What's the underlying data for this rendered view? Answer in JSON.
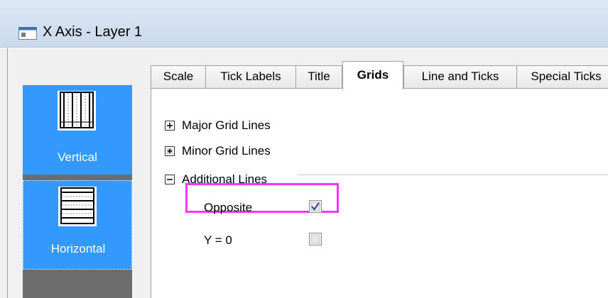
{
  "window": {
    "title": "X Axis - Layer 1"
  },
  "nav": {
    "items": [
      {
        "label": "Vertical",
        "selected": false
      },
      {
        "label": "Horizontal",
        "selected": true
      }
    ]
  },
  "tabs": [
    {
      "label": "Scale",
      "active": false
    },
    {
      "label": "Tick Labels",
      "active": false
    },
    {
      "label": "Title",
      "active": false
    },
    {
      "label": "Grids",
      "active": true
    },
    {
      "label": "Line and Ticks",
      "active": false
    },
    {
      "label": "Special Ticks",
      "active": false
    }
  ],
  "tree": {
    "major": {
      "label": "Major Grid Lines",
      "state": "collapsed"
    },
    "minor": {
      "label": "Minor Grid Lines",
      "state": "collapsed"
    },
    "additional": {
      "label": "Additional Lines",
      "state": "expanded"
    }
  },
  "additional_lines": {
    "opposite": {
      "label": "Opposite",
      "checked": true
    },
    "y_zero": {
      "label": "Y = 0",
      "checked": false
    }
  },
  "colors": {
    "nav_selected": "#3399ff",
    "highlight": "#ff33ff"
  }
}
